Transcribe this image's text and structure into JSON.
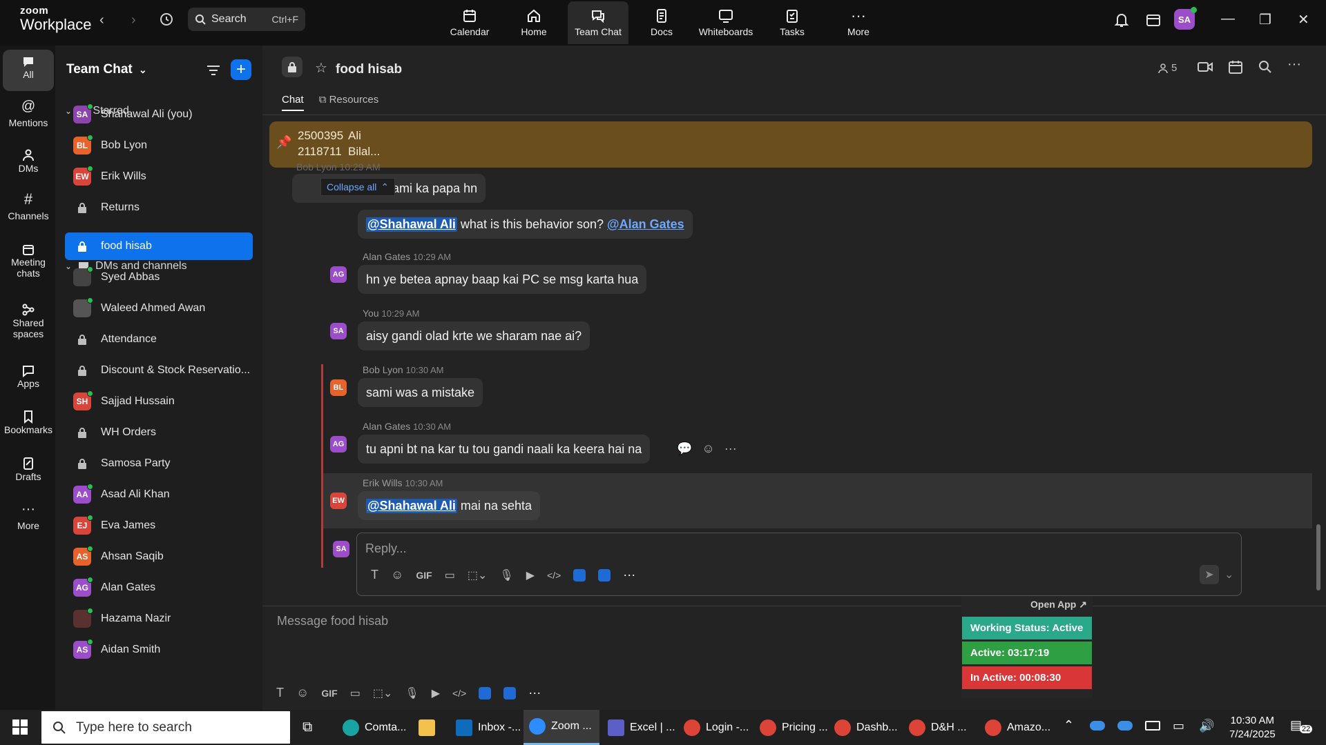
{
  "app": {
    "logo_top": "zoom",
    "logo_bottom": "Workplace"
  },
  "search": {
    "label": "Search",
    "shortcut": "Ctrl+F"
  },
  "top_tabs": [
    {
      "label": "Calendar",
      "icon": "calendar-icon"
    },
    {
      "label": "Home",
      "icon": "home-icon"
    },
    {
      "label": "Team Chat",
      "icon": "chat-icon",
      "active": true
    },
    {
      "label": "Docs",
      "icon": "docs-icon"
    },
    {
      "label": "Whiteboards",
      "icon": "whiteboard-icon"
    },
    {
      "label": "Tasks",
      "icon": "tasks-icon"
    },
    {
      "label": "More",
      "icon": "more-icon"
    }
  ],
  "user_avatar": "SA",
  "rail": [
    {
      "label": "All"
    },
    {
      "label": "Mentions"
    },
    {
      "label": "DMs"
    },
    {
      "label": "Channels"
    },
    {
      "label": "Meeting chats"
    },
    {
      "label": "Shared spaces"
    },
    {
      "label": "Apps"
    },
    {
      "label": "Bookmarks"
    },
    {
      "label": "Drafts"
    },
    {
      "label": "More"
    }
  ],
  "sidebar": {
    "title": "Team Chat",
    "starred_label": "Starred",
    "dms_label": "DMs and channels",
    "starred": [
      {
        "label": "Shahawal Ali (you)",
        "initials": "SA",
        "color": "#8e44ad"
      },
      {
        "label": "Bob Lyon",
        "initials": "BL",
        "color": "#e8622c"
      },
      {
        "label": "Erik Wills",
        "initials": "EW",
        "color": "#d9443b"
      },
      {
        "label": "Returns",
        "initials": "",
        "color": ""
      }
    ],
    "channels": [
      {
        "label": "food hisab",
        "initials": "",
        "color": ""
      },
      {
        "label": "Syed Abbas",
        "initials": "",
        "color": "#444"
      },
      {
        "label": "Waleed Ahmed Awan",
        "initials": "",
        "color": "#555"
      },
      {
        "label": "Attendance",
        "initials": "",
        "color": ""
      },
      {
        "label": "Discount & Stock Reservatio...",
        "initials": "",
        "color": ""
      },
      {
        "label": "Sajjad Hussain",
        "initials": "SH",
        "color": "#d9443b"
      },
      {
        "label": "WH Orders",
        "initials": "",
        "color": ""
      },
      {
        "label": "Samosa Party",
        "initials": "",
        "color": ""
      },
      {
        "label": "Asad Ali Khan",
        "initials": "AA",
        "color": "#9b4dca"
      },
      {
        "label": "Eva James",
        "initials": "EJ",
        "color": "#d9443b"
      },
      {
        "label": "Ahsan Saqib",
        "initials": "AS",
        "color": "#e8622c"
      },
      {
        "label": "Alan Gates",
        "initials": "AG",
        "color": "#9b4dca"
      },
      {
        "label": "Hazama Nazir",
        "initials": "",
        "color": "#5a3030"
      },
      {
        "label": "Aidan Smith",
        "initials": "AS",
        "color": "#9b4dca"
      }
    ]
  },
  "channel": {
    "name": "food hisab",
    "member_count": "5"
  },
  "tabs": {
    "chat": "Chat",
    "resources": "Resources"
  },
  "pinned": {
    "line1_num": "2500395",
    "line1_name": "Ali",
    "line2_num": "2118711",
    "line2_name": "Bilal..."
  },
  "collapse_label": "Collapse all",
  "messages": {
    "m0_sender": "Bob Lyon 10:29 AM",
    "m0_text": "ai hi sami ka papa hn",
    "m1_mention": "@Shahawal Ali",
    "m1_text": " what is this behavior son? ",
    "m1_link": "@Alan Gates",
    "m2_sender": "Alan Gates",
    "m2_time": "10:29 AM",
    "m2_text": "hn ye betea apnay baap kai PC se msg karta hua",
    "m2_initials": "AG",
    "m3_sender": "You",
    "m3_time": "10:29 AM",
    "m3_text": "aisy gandi olad krte we sharam nae ai?",
    "m3_initials": "SA",
    "m4_sender": "Bob Lyon",
    "m4_time": "10:30 AM",
    "m4_text": "sami was a mistake",
    "m4_initials": "BL",
    "m5_sender": "Alan Gates",
    "m5_time": "10:30 AM",
    "m5_text": "tu apni bt na kar tu tou gandi naali ka keera hai na",
    "m5_initials": "AG",
    "m6_sender": "Erik Wills",
    "m6_time": "10:30 AM",
    "m6_mention": "@Shahawal Ali",
    "m6_text": " mai na sehta",
    "m6_initials": "EW"
  },
  "reply": {
    "placeholder": "Reply...",
    "avatar": "SA"
  },
  "composer": {
    "placeholder": "Message food hisab"
  },
  "overlay": {
    "open_app": "Open App ↗",
    "working_status": "Working Status: Active",
    "active": "Active: 03:17:19",
    "inactive": "In Active: 00:08:30"
  },
  "taskbar": {
    "search_placeholder": "Type here to search",
    "apps": [
      {
        "label": "Comta..."
      },
      {
        "label": ""
      },
      {
        "label": "Inbox -..."
      },
      {
        "label": "Zoom ..."
      },
      {
        "label": "Excel | ..."
      },
      {
        "label": "Login -..."
      },
      {
        "label": "Pricing ..."
      },
      {
        "label": "Dashb..."
      },
      {
        "label": "D&H ..."
      },
      {
        "label": "Amazo..."
      }
    ],
    "time": "10:30 AM",
    "date": "7/24/2025",
    "notif_count": "22"
  },
  "colors": {
    "accent": "#0e72ed",
    "pin_bg": "#6b4e1e",
    "working": "#2aa88a",
    "active": "#2ea043",
    "inactive": "#d93737"
  }
}
